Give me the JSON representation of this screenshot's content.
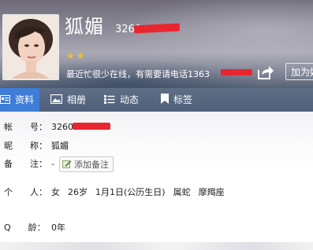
{
  "profile": {
    "nickname": "狐媚",
    "qq_number": "3260",
    "stars": 2,
    "status": "最近忙很少在线，有需要请电话1363"
  },
  "actions": {
    "share_icon": "share-icon",
    "add_friend_label": "加为好友"
  },
  "tabs": [
    {
      "label": "资料",
      "icon": "profile-card-icon",
      "active": true
    },
    {
      "label": "相册",
      "icon": "photo-icon",
      "active": false
    },
    {
      "label": "动态",
      "icon": "feed-list-icon",
      "active": false
    },
    {
      "label": "标签",
      "icon": "bookmark-icon",
      "active": false
    }
  ],
  "info": {
    "account_label": "帐　　号：",
    "account_value": "32605",
    "nickname_label": "昵　　称：",
    "nickname_value": "狐媚",
    "remark_label": "备　　注：",
    "remark_value": "-",
    "remark_button": "添加备注",
    "personal_label": "个　　人：",
    "personal": [
      "女",
      "26岁",
      "1月1日(公历生日)",
      "属蛇",
      "摩羯座"
    ],
    "qage_label": "Q　　龄：",
    "qage_value": "0年"
  },
  "colors": {
    "accent_tab": "#3f7ed8",
    "tabbar": "#55667f",
    "star": "#f5c21b",
    "redaction": "#e8262f"
  }
}
